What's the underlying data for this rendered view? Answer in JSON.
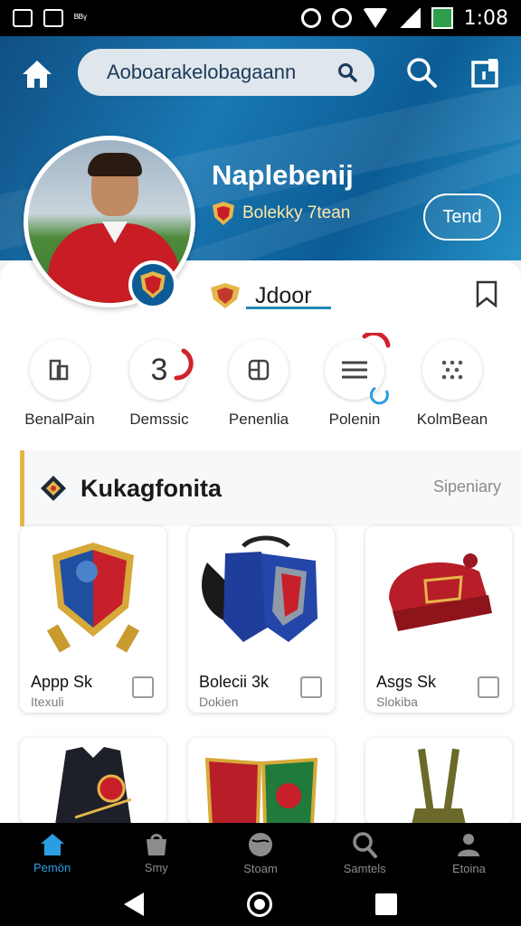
{
  "status_bar": {
    "time": "1:08",
    "notif_text": "ᴮᴮᵞ"
  },
  "search": {
    "text": "Aoboarakelobagaann"
  },
  "profile": {
    "name": "Naplebenij",
    "team": "Bolekky 7tean",
    "follow_label": "Tend"
  },
  "club": {
    "name": "Jdoor"
  },
  "actions": [
    {
      "label": "BenalPain",
      "icon": "document-icon"
    },
    {
      "label": "Demssic",
      "icon": "number-icon",
      "glyph": "3"
    },
    {
      "label": "Penenlia",
      "icon": "grid-icon"
    },
    {
      "label": "Polenin",
      "icon": "list-icon"
    },
    {
      "label": "KolmBean",
      "icon": "dots-icon"
    }
  ],
  "section": {
    "title": "Kukagfonita",
    "link": "Sipeniary"
  },
  "items": [
    {
      "title": "Appp Sk",
      "sub": "Itexuli",
      "icon": "shield-crest-icon"
    },
    {
      "title": "Bolecii 3k",
      "sub": "Dokien",
      "icon": "gloves-icon"
    },
    {
      "title": "Asgs Sk",
      "sub": "Slokiba",
      "icon": "beanie-icon"
    },
    {
      "title": "",
      "sub": "",
      "icon": "vest-icon"
    },
    {
      "title": "",
      "sub": "",
      "icon": "double-crest-icon"
    },
    {
      "title": "",
      "sub": "",
      "icon": "suspenders-icon"
    }
  ],
  "bottom_nav": [
    {
      "label": "Pemön",
      "active": true
    },
    {
      "label": "Smy",
      "active": false
    },
    {
      "label": "Stoam",
      "active": false
    },
    {
      "label": "Samtels",
      "active": false
    },
    {
      "label": "Etoina",
      "active": false
    }
  ],
  "colors": {
    "header": "#1a78b3",
    "accent": "#2a9ee0",
    "jersey": "#c81d24",
    "gold": "#e5b64a"
  }
}
